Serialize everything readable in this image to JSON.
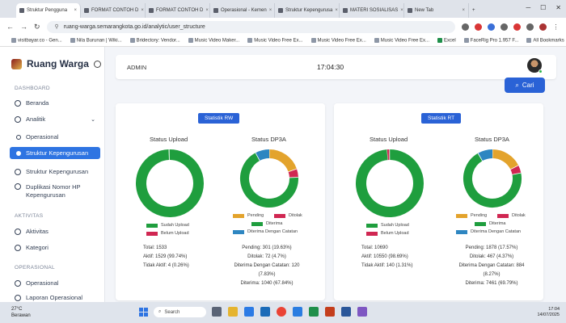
{
  "browser": {
    "tabs": [
      {
        "label": "Struktur Pengguna",
        "active": true
      },
      {
        "label": "FORMAT CONTOH D",
        "active": false
      },
      {
        "label": "FORMAT CONTOH D",
        "active": false
      },
      {
        "label": "Operasional - Kemen",
        "active": false
      },
      {
        "label": "Struktur Kepengurusa",
        "active": false
      },
      {
        "label": "MATERI SOSIALISAS",
        "active": false
      },
      {
        "label": "New Tab",
        "active": false
      }
    ],
    "url": "ruang-warga.semarangkota.go.id/analytic/user_structure",
    "bookmarks": [
      "visitbayar.co - Gen...",
      "Nila Burunan | Wiki...",
      "Bridectory: Vendor...",
      "Music Video Maker...",
      "Music Video Free Ex...",
      "Music Video Free Ex...",
      "Music Video Free Ex...",
      "Excel",
      "FaceRig Pro 1.957 F...",
      "All Bookmarks"
    ]
  },
  "app": {
    "brand": "Ruang Warga",
    "sections": {
      "dashboard": "DASHBOARD",
      "aktivitas": "AKTIVITAS",
      "operasional": "OPERASIONAL"
    },
    "nav": {
      "beranda": "Beranda",
      "analitik": "Analitik",
      "operasional_sub": "Operasional",
      "struktur_kepengurusan_sub": "Struktur Kepengurusan",
      "struktur_kepengurusan": "Struktur Kepengurusan",
      "duplikasi_line1": "Duplikasi Nomor HP",
      "duplikasi_line2": "Kepengurusan",
      "aktivitas": "Aktivitas",
      "kategori": "Kategori",
      "operasional": "Operasional",
      "laporan": "Laporan Operasional"
    },
    "topbar": {
      "user": "ADMIN",
      "time": "17:04:30"
    },
    "search_button": "Cari"
  },
  "colors": {
    "green": "#1f9e3e",
    "red": "#d02752",
    "orange": "#e3a32c",
    "blue": "#2e86c1",
    "primary": "#2a62d6"
  },
  "rw": {
    "title": "Statistik RW",
    "upload": {
      "title": "Status Upload",
      "legend": {
        "sudah": "Sudah Upload",
        "belum": "Belum Upload"
      },
      "values": {
        "sudah": 1529,
        "belum": 4
      },
      "stats": [
        "Total: 1533",
        "Aktif: 1529 (99.74%)",
        "Tidak Aktif: 4 (0.26%)"
      ]
    },
    "dp3a": {
      "title": "Status DP3A",
      "legend": {
        "pending": "Pending",
        "ditolak": "Ditolak",
        "diterima": "Diterima",
        "dengan_catatan": "Diterima Dengan Catatan"
      },
      "values": {
        "diterima": 1040,
        "pending": 301,
        "ditolak": 72,
        "dengan_catatan": 120
      },
      "stats": [
        "Pending: 301 (19.63%)",
        "Ditolak: 72 (4.7%)",
        "Diterima Dengan Catatan: 120",
        "(7.83%)",
        "Diterima: 1040 (67.84%)"
      ]
    }
  },
  "rt": {
    "title": "Statistik RT",
    "upload": {
      "title": "Status Upload",
      "legend": {
        "sudah": "Sudah Upload",
        "belum": "Belum Upload"
      },
      "values": {
        "sudah": 10550,
        "belum": 140
      },
      "stats": [
        "Total: 10690",
        "Aktif: 10550 (98.69%)",
        "Tidak Aktif: 140 (1.31%)"
      ]
    },
    "dp3a": {
      "title": "Status DP3A",
      "legend": {
        "pending": "Pending",
        "ditolak": "Ditolak",
        "diterima": "Diterima",
        "dengan_catatan": "Diterima Dengan Catatan"
      },
      "values": {
        "diterima": 7461,
        "pending": 1878,
        "ditolak": 467,
        "dengan_catatan": 884
      },
      "stats": [
        "Pending: 1878 (17.57%)",
        "Ditolak: 467 (4.37%)",
        "Diterima Dengan Catatan: 884",
        "(8.27%)",
        "Diterima: 7461 (69.79%)"
      ]
    }
  },
  "taskbar": {
    "weather_temp": "27°C",
    "weather_text": "Berawan",
    "search": "Search",
    "time": "17:04",
    "date": "14/07/2025"
  }
}
